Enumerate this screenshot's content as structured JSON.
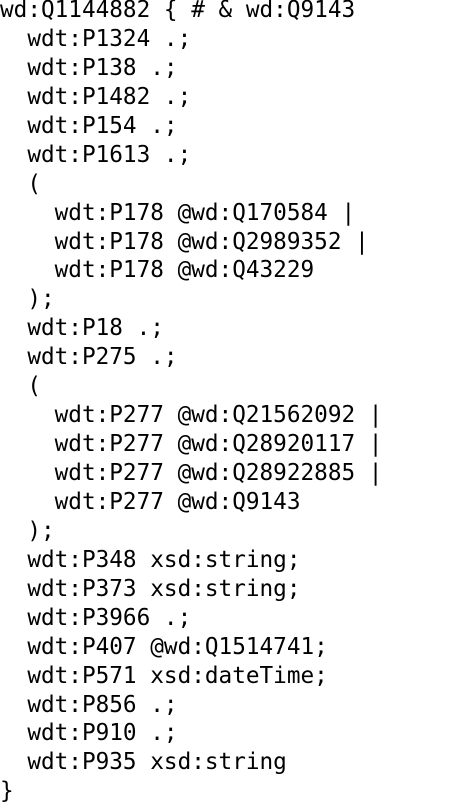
{
  "document": {
    "lines": [
      {
        "indent": 0,
        "text": "wd:Q1144882 { # & wd:Q9143"
      },
      {
        "indent": 1,
        "text": "wdt:P1324 .;"
      },
      {
        "indent": 1,
        "text": "wdt:P138 .;"
      },
      {
        "indent": 1,
        "text": "wdt:P1482 .;"
      },
      {
        "indent": 1,
        "text": "wdt:P154 .;"
      },
      {
        "indent": 1,
        "text": "wdt:P1613 .;"
      },
      {
        "indent": 1,
        "text": "("
      },
      {
        "indent": 2,
        "text": "wdt:P178 @wd:Q170584 |"
      },
      {
        "indent": 2,
        "text": "wdt:P178 @wd:Q2989352 |"
      },
      {
        "indent": 2,
        "text": "wdt:P178 @wd:Q43229"
      },
      {
        "indent": 1,
        "text": ");"
      },
      {
        "indent": 1,
        "text": "wdt:P18 .;"
      },
      {
        "indent": 1,
        "text": "wdt:P275 .;"
      },
      {
        "indent": 1,
        "text": "("
      },
      {
        "indent": 2,
        "text": "wdt:P277 @wd:Q21562092 |"
      },
      {
        "indent": 2,
        "text": "wdt:P277 @wd:Q28920117 |"
      },
      {
        "indent": 2,
        "text": "wdt:P277 @wd:Q28922885 |"
      },
      {
        "indent": 2,
        "text": "wdt:P277 @wd:Q9143"
      },
      {
        "indent": 1,
        "text": ");"
      },
      {
        "indent": 1,
        "text": "wdt:P348 xsd:string;"
      },
      {
        "indent": 1,
        "text": "wdt:P373 xsd:string;"
      },
      {
        "indent": 1,
        "text": "wdt:P3966 .;"
      },
      {
        "indent": 1,
        "text": "wdt:P407 @wd:Q1514741;"
      },
      {
        "indent": 1,
        "text": "wdt:P571 xsd:dateTime;"
      },
      {
        "indent": 1,
        "text": "wdt:P856 .;"
      },
      {
        "indent": 1,
        "text": "wdt:P910 .;"
      },
      {
        "indent": 1,
        "text": "wdt:P935 xsd:string"
      },
      {
        "indent": 0,
        "text": "}"
      }
    ]
  }
}
